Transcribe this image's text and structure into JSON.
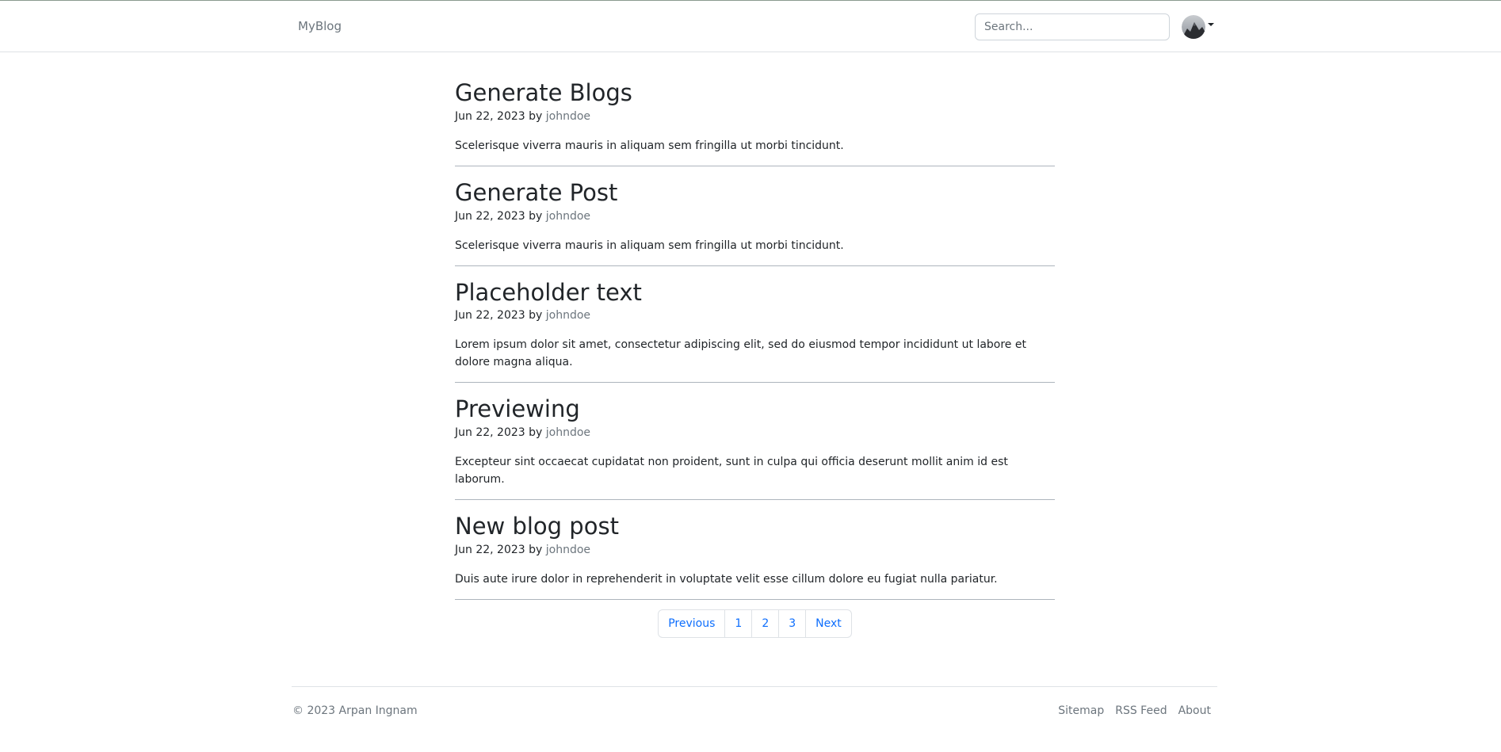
{
  "navbar": {
    "brand": "MyBlog",
    "search_placeholder": "Search...",
    "avatar_icon": "user-avatar"
  },
  "posts": [
    {
      "title": "Generate Blogs",
      "date": "Jun 22, 2023",
      "by": "by",
      "author": "johndoe",
      "excerpt": "Scelerisque viverra mauris in aliquam sem fringilla ut morbi tincidunt."
    },
    {
      "title": "Generate Post",
      "date": "Jun 22, 2023",
      "by": "by",
      "author": "johndoe",
      "excerpt": "Scelerisque viverra mauris in aliquam sem fringilla ut morbi tincidunt."
    },
    {
      "title": "Placeholder text",
      "date": "Jun 22, 2023",
      "by": "by",
      "author": "johndoe",
      "excerpt": "Lorem ipsum dolor sit amet, consectetur adipiscing elit, sed do eiusmod tempor incididunt ut labore et dolore magna aliqua."
    },
    {
      "title": "Previewing",
      "date": "Jun 22, 2023",
      "by": "by",
      "author": "johndoe",
      "excerpt": "Excepteur sint occaecat cupidatat non proident, sunt in culpa qui officia deserunt mollit anim id est laborum."
    },
    {
      "title": "New blog post",
      "date": "Jun 22, 2023",
      "by": "by",
      "author": "johndoe",
      "excerpt": "Duis aute irure dolor in reprehenderit in voluptate velit esse cillum dolore eu fugiat nulla pariatur."
    }
  ],
  "pagination": {
    "previous": "Previous",
    "pages": [
      "1",
      "2",
      "3"
    ],
    "next": "Next"
  },
  "footer": {
    "copyright": "© 2023 Arpan Ingnam",
    "links": [
      "Sitemap",
      "RSS Feed",
      "About"
    ]
  },
  "colors": {
    "link_blue": "#0d6efd",
    "muted": "#6c757d",
    "text": "#212529"
  }
}
